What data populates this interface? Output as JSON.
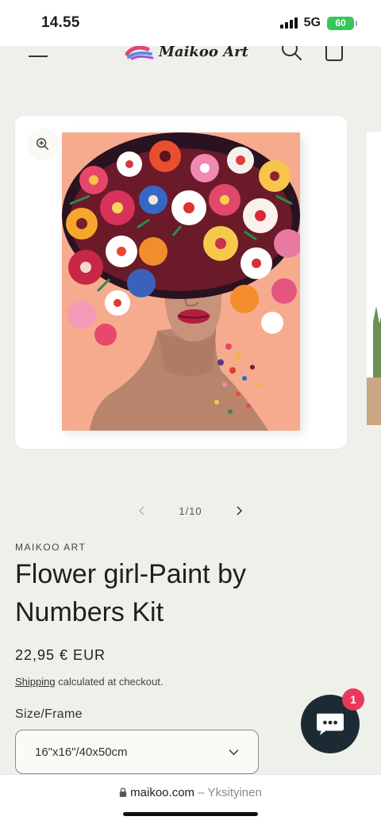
{
  "status_bar": {
    "time": "14.55",
    "network": "5G",
    "battery": "60"
  },
  "header": {
    "logo_text": "Maikoo Art"
  },
  "gallery": {
    "counter": "1/10"
  },
  "product": {
    "vendor": "MAIKOO ART",
    "title": "Flower girl-Paint by Numbers Kit",
    "price": "22,95 € EUR",
    "shipping_link": "Shipping",
    "shipping_text": " calculated at checkout.",
    "size_label": "Size/Frame",
    "size_value": "16\"x16\"/40x50cm"
  },
  "chat": {
    "badge_count": "1"
  },
  "browser": {
    "domain": "maikoo.com",
    "suffix": " – Yksityinen"
  },
  "colors": {
    "background": "#eef0ea",
    "painting_bg": "#f5a98c",
    "chat_button": "#1c2a33",
    "badge": "#e8385b",
    "battery": "#34c759"
  }
}
